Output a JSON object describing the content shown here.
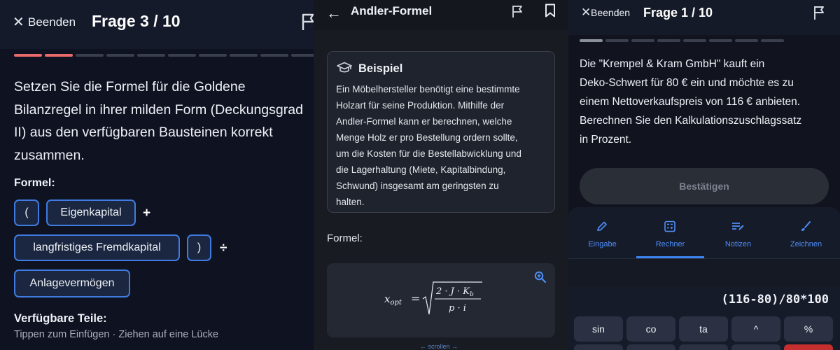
{
  "panel1": {
    "exit_label": "Beenden",
    "title": "Frage 3 / 10",
    "progress": {
      "total": 10,
      "done": 2,
      "done_color": "#e96a6a",
      "todo_color": "#3a3f4d"
    },
    "question_lines": [
      "Setzen Sie die Formel für die Goldene",
      "Bilanzregel in ihrer milden Form (Deckungsgrad",
      "II) aus den verfügbaren Bausteinen korrekt",
      "zusammen."
    ],
    "formula_label": "Formel:",
    "chips": [
      "(",
      "Eigenkapital",
      "langfristiges Fremdkapital",
      ")",
      "Anlagevermögen"
    ],
    "operators": [
      "+",
      "÷"
    ],
    "available_label": "Verfügbare Teile:",
    "hint": "Tippen zum Einfügen · Ziehen auf eine Lücke"
  },
  "panel2": {
    "title": "Andler-Formel",
    "example_title": "Beispiel",
    "example_lines": [
      "Ein Möbelhersteller benötigt eine bestimmte",
      "Holzart für seine Produktion. Mithilfe der",
      "Andler-Formel kann er berechnen, welche",
      "Menge Holz er pro Bestellung ordern sollte,",
      "um die Kosten für die Bestellabwicklung und",
      "die Lagerhaltung (Miete, Kapitalbindung,",
      "Schwund) insgesamt am geringsten zu",
      "halten."
    ],
    "formula_label": "Formel:",
    "formula": {
      "lhs": "x",
      "lhs_sub": "opt",
      "numerator": "2 · J · K",
      "numerator_sub": "b",
      "denominator": "p · i"
    },
    "scroll_hint": "← scrollen →"
  },
  "panel3": {
    "exit_label": "Beenden",
    "title": "Frage 1 / 10",
    "progress": {
      "total": 8,
      "done": 1,
      "done_color": "#8a8f9c",
      "todo_color": "#3a3f4d"
    },
    "question_lines": [
      "Die \"Krempel & Kram GmbH\" kauft ein",
      "Deko-Schwert für 80 € ein und möchte es zu",
      "einem Nettoverkaufspreis von 116 € anbieten.",
      "Berechnen Sie den Kalkulationszuschlagssatz",
      "in Prozent."
    ],
    "confirm_label": "Bestätigen",
    "tabs": [
      {
        "label": "Eingabe",
        "icon": "pencil-icon"
      },
      {
        "label": "Rechner",
        "icon": "calculator-icon",
        "active": true
      },
      {
        "label": "Notizen",
        "icon": "notes-icon"
      },
      {
        "label": "Zeichnen",
        "icon": "brush-icon"
      }
    ],
    "calculator": {
      "expression": "(116-80)/80*100",
      "keys": [
        "sin",
        "co",
        "ta",
        "^",
        "%"
      ]
    },
    "accent_color": "#3d86f2"
  }
}
